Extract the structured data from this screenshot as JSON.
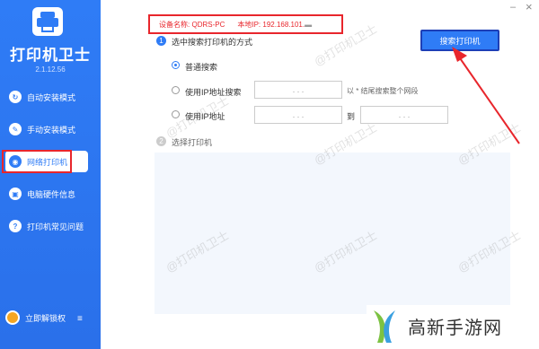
{
  "app": {
    "name": "打印机卫士",
    "version": "2.1.12.56",
    "minimize": "–",
    "close": "×"
  },
  "sidebar": {
    "items": [
      {
        "label": "自动安装模式",
        "icon": "auto-install-icon"
      },
      {
        "label": "手动安装模式",
        "icon": "wrench-icon"
      },
      {
        "label": "网络打印机",
        "icon": "network-icon"
      },
      {
        "label": "电脑硬件信息",
        "icon": "hardware-icon"
      },
      {
        "label": "打印机常见问题",
        "icon": "help-icon"
      }
    ],
    "unlock_label": "立即解锁权",
    "menu_icon": "≡"
  },
  "device": {
    "name_label": "设备名称:",
    "name_value": "QDRS-PC",
    "ip_label": "本地IP:",
    "ip_value": "192.168.101.",
    "ip_masked": "▬"
  },
  "section1": {
    "step": "1",
    "title": "选中搜索打印机的方式",
    "search_button": "搜索打印机",
    "options": [
      {
        "label": "普通搜索",
        "checked": true
      },
      {
        "label": "使用IP地址搜索",
        "checked": false
      },
      {
        "label": "使用IP地址",
        "checked": false
      }
    ],
    "ip_dots": ". . .",
    "hint": "以 * 结尾搜索整个网段",
    "to_label": "到"
  },
  "section2": {
    "step": "2",
    "title": "选择打印机"
  },
  "watermark": "@打印机卫士",
  "site_logo": {
    "text": "高新手游网"
  },
  "colors": {
    "sidebar": "#2f7cf6",
    "accent": "#2f7cf6",
    "annotation": "#e8262c"
  }
}
